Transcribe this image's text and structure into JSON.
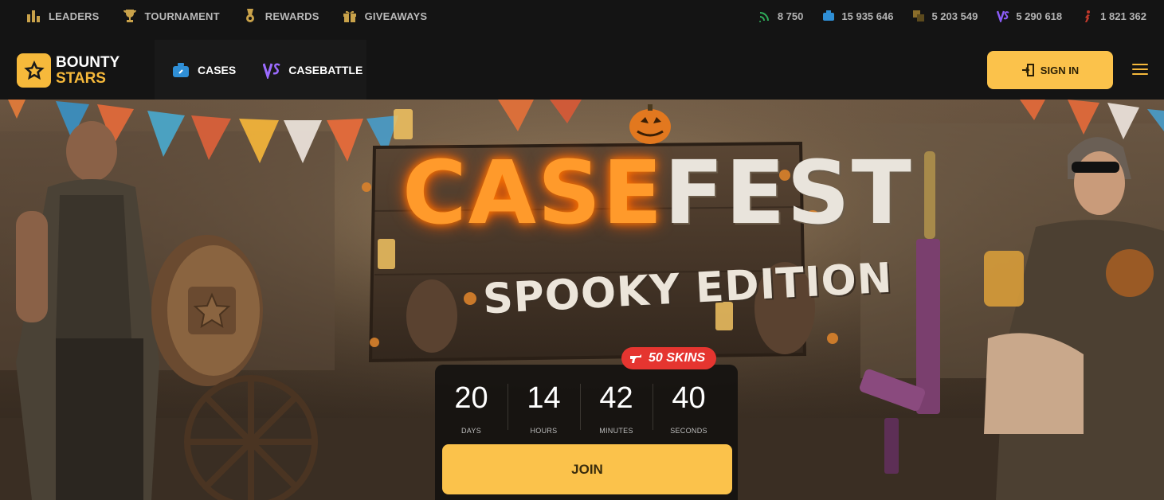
{
  "topnav": [
    {
      "label": "LEADERS",
      "icon": "leaders-icon"
    },
    {
      "label": "TOURNAMENT",
      "icon": "trophy-icon"
    },
    {
      "label": "REWARDS",
      "icon": "medal-icon"
    },
    {
      "label": "GIVEAWAYS",
      "icon": "gift-icon"
    }
  ],
  "stats": [
    {
      "value": "8 750",
      "icon": "online-signal-icon",
      "color": "#2fae5a"
    },
    {
      "value": "15 935 646",
      "icon": "case-icon",
      "color": "#2f8fd6"
    },
    {
      "value": "5 203 549",
      "icon": "upgrade-icon",
      "color": "#8a6d2a"
    },
    {
      "value": "5 290 618",
      "icon": "casebattle-icon",
      "color": "#8b5cf6"
    },
    {
      "value": "1 821 362",
      "icon": "user-icon",
      "color": "#c0392b"
    }
  ],
  "brand": {
    "line1": "BOUNTY",
    "line2": "STARS",
    "accent": "#f6b93b"
  },
  "mainnav": [
    {
      "label": "CASES",
      "icon": "cases-icon"
    },
    {
      "label": "CASEBATTLE",
      "icon": "versus-icon"
    }
  ],
  "header": {
    "signin_label": "SIGN IN"
  },
  "banner": {
    "title_part1": "CASE",
    "title_part2": "FEST",
    "subtitle": "SPOOKY EDITION",
    "badge": "50 SKINS"
  },
  "countdown": [
    {
      "value": "20",
      "label": "DAYS"
    },
    {
      "value": "14",
      "label": "HOURS"
    },
    {
      "value": "42",
      "label": "MINUTES"
    },
    {
      "value": "40",
      "label": "SECONDS"
    }
  ],
  "join_label": "JOIN"
}
